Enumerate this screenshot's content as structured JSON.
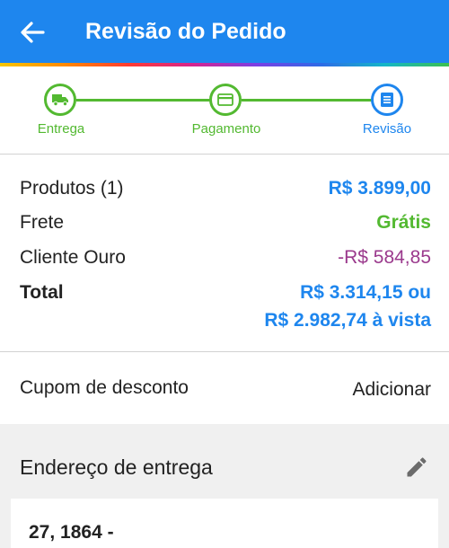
{
  "appbar": {
    "title": "Revisão do Pedido",
    "back_icon": "arrow-left-icon"
  },
  "colors": {
    "primary": "#1e86ee",
    "green": "#53b931",
    "discount": "#9b3a8d",
    "value_blue": "#1e86ee"
  },
  "stepper": {
    "steps": [
      {
        "label": "Entrega",
        "icon": "truck-icon",
        "state": "completed"
      },
      {
        "label": "Pagamento",
        "icon": "credit-card-icon",
        "state": "completed"
      },
      {
        "label": "Revisão",
        "icon": "document-icon",
        "state": "current"
      }
    ]
  },
  "summary": {
    "products_label": "Produtos (1)",
    "products_value": "R$ 3.899,00",
    "shipping_label": "Frete",
    "shipping_value": "Grátis",
    "gold_label": "Cliente Ouro",
    "gold_value": "-R$ 584,85",
    "total_label": "Total",
    "total_value": "R$ 3.314,15 ou",
    "total_cash_value": "R$ 2.982,74 à vista"
  },
  "coupon": {
    "label": "Cupom de desconto",
    "action": "Adicionar"
  },
  "address": {
    "header": "Endereço de entrega",
    "edit_icon": "pencil-icon",
    "line1": "27, 1864 -"
  }
}
